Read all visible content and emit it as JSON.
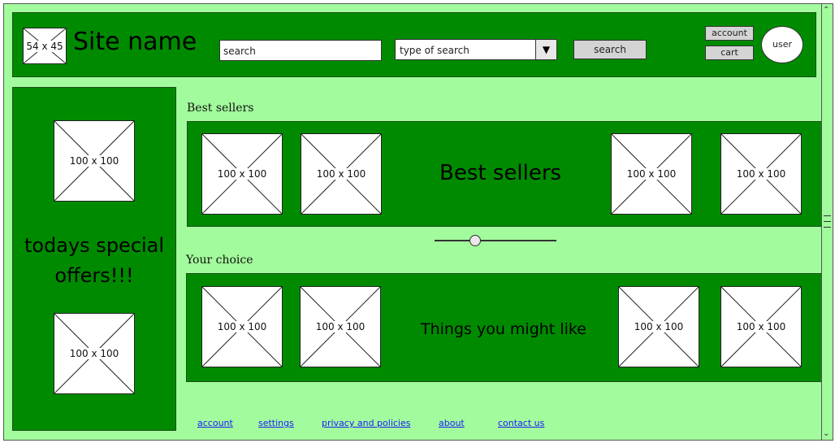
{
  "header": {
    "logo_dims": "54 x 45",
    "site_name": "Site name",
    "search_placeholder": "search",
    "search_type_value": "type of search",
    "search_button": "search",
    "account_button": "account",
    "cart_button": "cart",
    "user_label": "user",
    "dropdown_icon": "triangle-down-icon"
  },
  "sidebar": {
    "top_image_dims": "100 x 100",
    "title": "todays special offers!!!",
    "bottom_image_dims": "100 x 100"
  },
  "best_sellers": {
    "label": "Best sellers",
    "title": "Best sellers",
    "items": [
      {
        "dims": "100 x 100"
      },
      {
        "dims": "100 x 100"
      },
      {
        "dims": "100 x 100"
      },
      {
        "dims": "100 x 100"
      }
    ]
  },
  "your_choice": {
    "label": "Your choice",
    "title": "Things you might like",
    "items": [
      {
        "dims": "100 x 100"
      },
      {
        "dims": "100 x 100"
      },
      {
        "dims": "100 x 100"
      },
      {
        "dims": "100 x 100"
      }
    ]
  },
  "footer": {
    "links": [
      "account",
      "settings",
      "privacy and policies",
      "about",
      "contact us"
    ]
  },
  "colors": {
    "page_bg": "#a2fb9c",
    "panel_green": "#008a00",
    "link_blue": "#1a1aff",
    "button_gray": "#d4d4d4"
  }
}
